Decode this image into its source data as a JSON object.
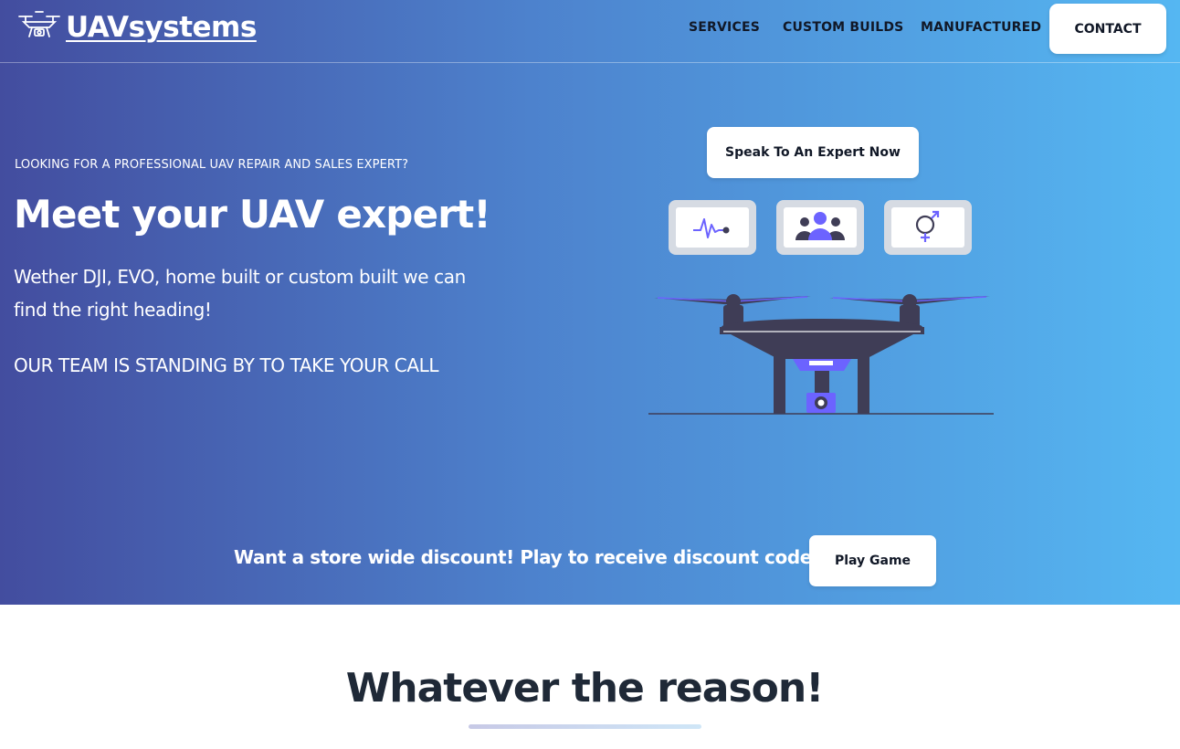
{
  "brand": {
    "name": "UAVsystems",
    "icon": "drone-icon"
  },
  "nav": {
    "links": [
      "SERVICES",
      "CUSTOM BUILDS",
      "MANUFACTURED"
    ],
    "contact": "CONTACT"
  },
  "hero": {
    "eyebrow": "LOOKING FOR A PROFESSIONAL UAV REPAIR AND SALES EXPERT?",
    "headline": "Meet your UAV expert!",
    "lead": "Wether DJI, EVO, home built or custom built we can find the right heading!",
    "standby": "OUR TEAM IS STANDING BY TO TAKE YOUR CALL",
    "expert_button": "Speak To An Expert Now",
    "cards": [
      {
        "icon": "heartbeat-icon"
      },
      {
        "icon": "people-group-icon"
      },
      {
        "icon": "gender-symbol-icon"
      }
    ],
    "illustration": "drone-illustration"
  },
  "discount": {
    "text": "Want a store wide discount! Play to receive discount code!",
    "button": "Play Game"
  },
  "section": {
    "title": "Whatever the reason!"
  },
  "colors": {
    "gradient_start": "#434d9f",
    "gradient_end": "#55b7f2",
    "accent": "#6c63ff",
    "dark": "#3f3d56",
    "heading_text": "#1f2937"
  }
}
